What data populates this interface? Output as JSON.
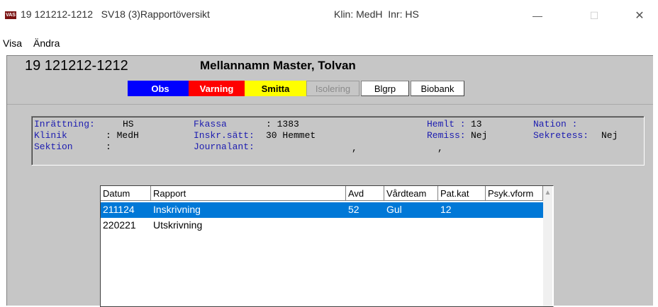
{
  "titlebar": {
    "app_icon_label": "VAS",
    "title": "19 121212-1212   SV18 (3)Rapportöversikt",
    "klin": "Klin: MedH  Inr: HS",
    "min_glyph": "—",
    "max_glyph": "☐",
    "close_glyph": "✕"
  },
  "menu": {
    "items": [
      "Visa",
      "Ändra"
    ]
  },
  "patient": {
    "personnummer": "19 121212-1212",
    "name": "Mellannamn Master, Tolvan"
  },
  "flags": {
    "obs": "Obs",
    "varning": "Varning",
    "smitta": "Smitta",
    "isolering": "Isolering",
    "blgrp": "Blgrp",
    "biobank": "Biobank"
  },
  "info": {
    "inrattning_label": "Inrättning:",
    "inrattning_value": "HS",
    "klinik_label": "Klinik",
    "klinik_value": ": MedH",
    "sektion_label": "Sektion",
    "sektion_value": ":",
    "fkassa_label": "Fkassa",
    "fkassa_value": ": 1383",
    "inskr_label": "Inskr.sätt:",
    "inskr_value": "30 Hemmet",
    "journal_label": "Journalant:",
    "journal_value": ",",
    "hemlt_label": "Hemlt :",
    "hemlt_value": "13",
    "remiss_label": "Remiss:",
    "remiss_value": "Nej",
    "comma": ",",
    "nation_label": "Nation :",
    "nation_value": "",
    "sekretess_label": "Sekretess:",
    "sekretess_value": "Nej"
  },
  "list": {
    "columns": [
      "Datum",
      "Rapport",
      "Avd",
      "Vårdteam",
      "Pat.kat",
      "Psyk.vform"
    ],
    "rows": [
      {
        "datum": "211124",
        "rapport": "Inskrivning",
        "avd": "52",
        "vardteam": "Gul",
        "patkat": "12",
        "psyk": ""
      },
      {
        "datum": "220221",
        "rapport": "Utskrivning",
        "avd": "",
        "vardteam": "",
        "patkat": "",
        "psyk": ""
      }
    ],
    "selected_index": 0,
    "scroll_up_glyph": "▲"
  },
  "colors": {
    "selection": "#0078d7",
    "obs_bg": "#0000ff",
    "varning_bg": "#ff0000",
    "smitta_bg": "#ffff00",
    "label_blue": "#1c1cb0",
    "panel_grey": "#c6c6c6"
  }
}
